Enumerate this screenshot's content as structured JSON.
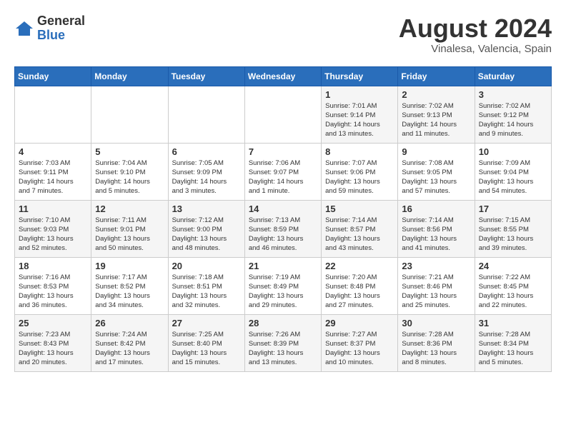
{
  "header": {
    "logo_general": "General",
    "logo_blue": "Blue",
    "month_year": "August 2024",
    "location": "Vinalesa, Valencia, Spain"
  },
  "weekdays": [
    "Sunday",
    "Monday",
    "Tuesday",
    "Wednesday",
    "Thursday",
    "Friday",
    "Saturday"
  ],
  "weeks": [
    [
      {
        "day": "",
        "info": ""
      },
      {
        "day": "",
        "info": ""
      },
      {
        "day": "",
        "info": ""
      },
      {
        "day": "",
        "info": ""
      },
      {
        "day": "1",
        "info": "Sunrise: 7:01 AM\nSunset: 9:14 PM\nDaylight: 14 hours\nand 13 minutes."
      },
      {
        "day": "2",
        "info": "Sunrise: 7:02 AM\nSunset: 9:13 PM\nDaylight: 14 hours\nand 11 minutes."
      },
      {
        "day": "3",
        "info": "Sunrise: 7:02 AM\nSunset: 9:12 PM\nDaylight: 14 hours\nand 9 minutes."
      }
    ],
    [
      {
        "day": "4",
        "info": "Sunrise: 7:03 AM\nSunset: 9:11 PM\nDaylight: 14 hours\nand 7 minutes."
      },
      {
        "day": "5",
        "info": "Sunrise: 7:04 AM\nSunset: 9:10 PM\nDaylight: 14 hours\nand 5 minutes."
      },
      {
        "day": "6",
        "info": "Sunrise: 7:05 AM\nSunset: 9:09 PM\nDaylight: 14 hours\nand 3 minutes."
      },
      {
        "day": "7",
        "info": "Sunrise: 7:06 AM\nSunset: 9:07 PM\nDaylight: 14 hours\nand 1 minute."
      },
      {
        "day": "8",
        "info": "Sunrise: 7:07 AM\nSunset: 9:06 PM\nDaylight: 13 hours\nand 59 minutes."
      },
      {
        "day": "9",
        "info": "Sunrise: 7:08 AM\nSunset: 9:05 PM\nDaylight: 13 hours\nand 57 minutes."
      },
      {
        "day": "10",
        "info": "Sunrise: 7:09 AM\nSunset: 9:04 PM\nDaylight: 13 hours\nand 54 minutes."
      }
    ],
    [
      {
        "day": "11",
        "info": "Sunrise: 7:10 AM\nSunset: 9:03 PM\nDaylight: 13 hours\nand 52 minutes."
      },
      {
        "day": "12",
        "info": "Sunrise: 7:11 AM\nSunset: 9:01 PM\nDaylight: 13 hours\nand 50 minutes."
      },
      {
        "day": "13",
        "info": "Sunrise: 7:12 AM\nSunset: 9:00 PM\nDaylight: 13 hours\nand 48 minutes."
      },
      {
        "day": "14",
        "info": "Sunrise: 7:13 AM\nSunset: 8:59 PM\nDaylight: 13 hours\nand 46 minutes."
      },
      {
        "day": "15",
        "info": "Sunrise: 7:14 AM\nSunset: 8:57 PM\nDaylight: 13 hours\nand 43 minutes."
      },
      {
        "day": "16",
        "info": "Sunrise: 7:14 AM\nSunset: 8:56 PM\nDaylight: 13 hours\nand 41 minutes."
      },
      {
        "day": "17",
        "info": "Sunrise: 7:15 AM\nSunset: 8:55 PM\nDaylight: 13 hours\nand 39 minutes."
      }
    ],
    [
      {
        "day": "18",
        "info": "Sunrise: 7:16 AM\nSunset: 8:53 PM\nDaylight: 13 hours\nand 36 minutes."
      },
      {
        "day": "19",
        "info": "Sunrise: 7:17 AM\nSunset: 8:52 PM\nDaylight: 13 hours\nand 34 minutes."
      },
      {
        "day": "20",
        "info": "Sunrise: 7:18 AM\nSunset: 8:51 PM\nDaylight: 13 hours\nand 32 minutes."
      },
      {
        "day": "21",
        "info": "Sunrise: 7:19 AM\nSunset: 8:49 PM\nDaylight: 13 hours\nand 29 minutes."
      },
      {
        "day": "22",
        "info": "Sunrise: 7:20 AM\nSunset: 8:48 PM\nDaylight: 13 hours\nand 27 minutes."
      },
      {
        "day": "23",
        "info": "Sunrise: 7:21 AM\nSunset: 8:46 PM\nDaylight: 13 hours\nand 25 minutes."
      },
      {
        "day": "24",
        "info": "Sunrise: 7:22 AM\nSunset: 8:45 PM\nDaylight: 13 hours\nand 22 minutes."
      }
    ],
    [
      {
        "day": "25",
        "info": "Sunrise: 7:23 AM\nSunset: 8:43 PM\nDaylight: 13 hours\nand 20 minutes."
      },
      {
        "day": "26",
        "info": "Sunrise: 7:24 AM\nSunset: 8:42 PM\nDaylight: 13 hours\nand 17 minutes."
      },
      {
        "day": "27",
        "info": "Sunrise: 7:25 AM\nSunset: 8:40 PM\nDaylight: 13 hours\nand 15 minutes."
      },
      {
        "day": "28",
        "info": "Sunrise: 7:26 AM\nSunset: 8:39 PM\nDaylight: 13 hours\nand 13 minutes."
      },
      {
        "day": "29",
        "info": "Sunrise: 7:27 AM\nSunset: 8:37 PM\nDaylight: 13 hours\nand 10 minutes."
      },
      {
        "day": "30",
        "info": "Sunrise: 7:28 AM\nSunset: 8:36 PM\nDaylight: 13 hours\nand 8 minutes."
      },
      {
        "day": "31",
        "info": "Sunrise: 7:28 AM\nSunset: 8:34 PM\nDaylight: 13 hours\nand 5 minutes."
      }
    ]
  ]
}
